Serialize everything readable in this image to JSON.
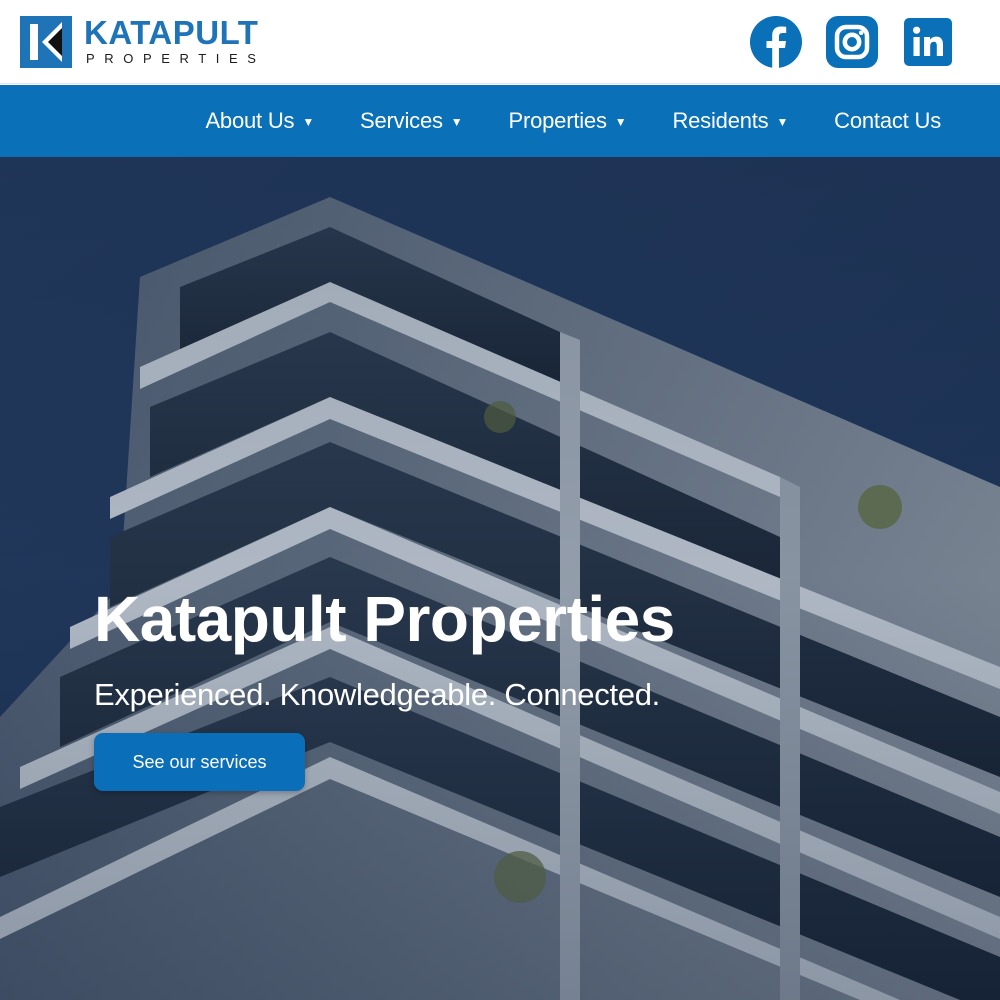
{
  "brand": {
    "name": "KATAPULT",
    "subtitle": "PROPERTIES",
    "primary_color": "#0a70b8",
    "logo_color": "#1f74b8"
  },
  "socials": [
    {
      "name": "facebook-icon",
      "glyph": "f"
    },
    {
      "name": "instagram-icon"
    },
    {
      "name": "linkedin-icon",
      "glyph": "in"
    }
  ],
  "nav": {
    "items": [
      {
        "label": "About Us",
        "caret": "▼"
      },
      {
        "label": "Services",
        "caret": "▼"
      },
      {
        "label": "Properties",
        "caret": "▼"
      },
      {
        "label": "Residents",
        "caret": "▼"
      },
      {
        "label": "Contact Us"
      }
    ]
  },
  "hero": {
    "title": "Katapult Properties",
    "tagline": "Experienced. Knowledgeable. Connected.",
    "cta_label": "See our services",
    "background_color": "#1f3557"
  }
}
